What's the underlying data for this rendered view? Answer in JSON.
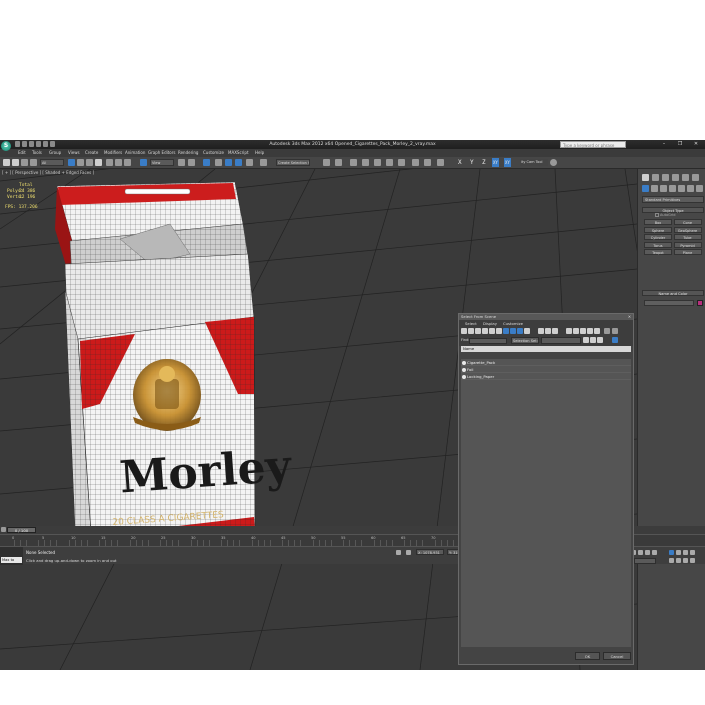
{
  "titlebar": {
    "app_title": "Autodesk 3ds Max  2012 x64     Opened_Cigarettes_Pack_Morley_2_vray.max",
    "search_placeholder": "Type a keyword or phrase",
    "app_icon": "3ds-max-logo"
  },
  "menubar": {
    "items": [
      "Edit",
      "Tools",
      "Group",
      "Views",
      "Create",
      "Modifiers",
      "Animation",
      "Graph Editors",
      "Rendering",
      "Customize",
      "MAXScript",
      "Help"
    ]
  },
  "toolbar": {
    "filter_dropdown": "All",
    "view_dropdown": "View",
    "selection_set": "Create Selection Se",
    "axis_x": "X",
    "axis_y": "Y",
    "axis_z": "Z",
    "axis_xy": "XY",
    "axis_xy2": "XY",
    "camera_tool": "ity Cam Tool"
  },
  "viewport": {
    "label": "[ + ] [ Perspective ] [ Shaded + Edged Faces ]",
    "stats": {
      "header": "Total",
      "polys_label": "Polys:",
      "polys_value": "24 386",
      "verts_label": "Verts:",
      "verts_value": "12 196"
    },
    "fps_label": "FPS:",
    "fps_value": "137.206",
    "pack_brand": "Morley",
    "pack_tagline": "20 CLASS A CIGARETTES"
  },
  "scene_explorer": {
    "title": "Select From Scene",
    "menu": [
      "Select",
      "Display",
      "Customize"
    ],
    "find_label": "Find:",
    "selection_set_label": "Selection Set:",
    "column_header": "Name",
    "items": [
      "Cigarette_Pack",
      "Foil",
      "Locking_Paper"
    ],
    "ok_label": "OK",
    "cancel_label": "Cancel"
  },
  "command_panel": {
    "category_dropdown": "Standard Primitives",
    "rollout_object_type": "Object Type",
    "autogrid_label": "AutoGrid",
    "primitives": [
      "Box",
      "Cone",
      "Sphere",
      "GeoSphere",
      "Cylinder",
      "Tube",
      "Torus",
      "Pyramid",
      "Teapot",
      "Plane"
    ],
    "rollout_name_color": "Name and Color",
    "color_swatch": "#b82e7d"
  },
  "time_slider": {
    "frame_display": "0 / 100",
    "ticks": [
      "0",
      "5",
      "10",
      "15",
      "20",
      "25",
      "30",
      "35",
      "40",
      "45",
      "50",
      "55",
      "60",
      "65",
      "70",
      "75",
      "80",
      "85",
      "90",
      "95",
      "100"
    ]
  },
  "status": {
    "maxscript_label": "Max to",
    "selection": "None Selected",
    "hint": "Click and drag up-and-down to zoom in and out",
    "x_coord": "X: 1078.931",
    "y_coord": "Y: 3190.099",
    "z_coord": "Z: 0.0",
    "grid": "Grid = 10.0cm",
    "auto_key": "Auto Key",
    "selected_dropdown": "Selected",
    "set_key": "Set Key",
    "key_filters": "Key Filters...",
    "add_time_tag": "Add Time Tag"
  }
}
